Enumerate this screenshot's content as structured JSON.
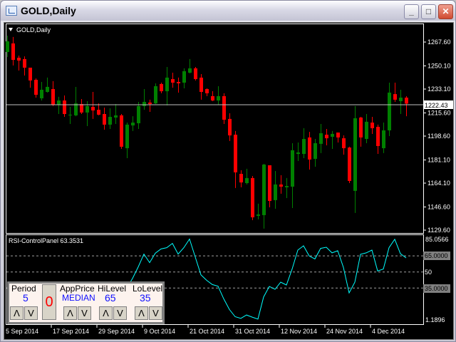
{
  "window": {
    "title": "GOLD,Daily",
    "minimize": "_",
    "maximize": "□",
    "close": "✕"
  },
  "chart": {
    "label": "GOLD,Daily",
    "indicator_label": "RSI-ControlPanel 63.3531",
    "bid": "1222.43",
    "price_ticks": [
      "1267.60",
      "1250.10",
      "1233.10",
      "1215.60",
      "1198.60",
      "1181.10",
      "1164.10",
      "1146.60",
      "1129.60"
    ],
    "rsi_ticks": {
      "max": "85.0566",
      "hi": "65.0000",
      "mid": "50",
      "lo": "35.0000",
      "min": "1.1896"
    },
    "time_labels": [
      "5 Sep 2014",
      "17 Sep 2014",
      "29 Sep 2014",
      "9 Oct 2014",
      "21 Oct 2014",
      "31 Oct 2014",
      "12 Nov 2014",
      "24 Nov 2014",
      "4 Dec 2014"
    ],
    "colors": {
      "bull": "#008000",
      "bear": "#ff0000",
      "rsi": "#00ffff",
      "grid": "#a0a0a0"
    }
  },
  "panel": {
    "period_label": "Period",
    "period_value": "5",
    "reset_label": "0",
    "appprice_label": "AppPrice",
    "appprice_value": "MEDIAN",
    "hilevel_label": "HiLevel",
    "hilevel_value": "65",
    "lolevel_label": "LoLevel",
    "lolevel_value": "35",
    "up": "Λ",
    "down": "V"
  },
  "chart_data": {
    "type": "candlestick",
    "symbol": "GOLD",
    "timeframe": "Daily",
    "ylim": [
      1129.6,
      1267.6
    ],
    "ohlc": [
      [
        1260.3,
        1272.3,
        1256.6,
        1268.1
      ],
      [
        1266.6,
        1271.3,
        1250.4,
        1254.5
      ],
      [
        1256.1,
        1257.7,
        1246.7,
        1254.0
      ],
      [
        1255.1,
        1257.1,
        1243.0,
        1248.8
      ],
      [
        1248.8,
        1248.8,
        1234.1,
        1239.4
      ],
      [
        1239.9,
        1240.9,
        1226.8,
        1228.9
      ],
      [
        1226.3,
        1238.3,
        1224.7,
        1232.6
      ],
      [
        1231.0,
        1241.5,
        1230.5,
        1234.7
      ],
      [
        1233.1,
        1238.9,
        1220.6,
        1221.6
      ],
      [
        1221.6,
        1227.4,
        1214.8,
        1224.7
      ],
      [
        1224.7,
        1228.4,
        1212.7,
        1214.8
      ],
      [
        1214.3,
        1220.0,
        1207.5,
        1214.3
      ],
      [
        1213.8,
        1234.7,
        1213.2,
        1222.6
      ],
      [
        1222.1,
        1225.8,
        1214.8,
        1215.9
      ],
      [
        1215.9,
        1224.2,
        1205.9,
        1220.6
      ],
      [
        1220.0,
        1231.0,
        1211.2,
        1217.4
      ],
      [
        1217.9,
        1222.6,
        1213.8,
        1214.3
      ],
      [
        1214.8,
        1219.5,
        1203.3,
        1207.0
      ],
      [
        1207.0,
        1219.0,
        1203.8,
        1212.7
      ],
      [
        1212.2,
        1222.1,
        1207.5,
        1213.8
      ],
      [
        1213.8,
        1214.8,
        1189.2,
        1190.8
      ],
      [
        1189.7,
        1208.5,
        1182.4,
        1207.0
      ],
      [
        1206.4,
        1213.2,
        1202.3,
        1208.5
      ],
      [
        1208.0,
        1223.7,
        1203.8,
        1220.6
      ],
      [
        1220.6,
        1233.1,
        1217.9,
        1223.7
      ],
      [
        1223.2,
        1225.3,
        1216.4,
        1222.1
      ],
      [
        1222.6,
        1237.3,
        1222.1,
        1235.2
      ],
      [
        1236.8,
        1237.8,
        1230.0,
        1231.5
      ],
      [
        1231.5,
        1249.3,
        1221.1,
        1241.5
      ],
      [
        1240.4,
        1245.1,
        1234.1,
        1237.8
      ],
      [
        1238.3,
        1241.5,
        1230.5,
        1237.3
      ],
      [
        1237.8,
        1248.3,
        1233.6,
        1246.2
      ],
      [
        1245.1,
        1255.1,
        1244.6,
        1248.3
      ],
      [
        1248.3,
        1249.3,
        1239.4,
        1240.4
      ],
      [
        1241.5,
        1244.1,
        1225.3,
        1231.0
      ],
      [
        1233.1,
        1233.6,
        1227.9,
        1230.0
      ],
      [
        1227.9,
        1231.5,
        1224.2,
        1224.7
      ],
      [
        1224.7,
        1235.2,
        1221.6,
        1227.9
      ],
      [
        1227.9,
        1230.0,
        1207.5,
        1210.6
      ],
      [
        1211.2,
        1215.3,
        1195.0,
        1199.1
      ],
      [
        1199.6,
        1202.3,
        1160.5,
        1172.0
      ],
      [
        1170.9,
        1173.5,
        1161.0,
        1164.6
      ],
      [
        1164.1,
        1174.6,
        1163.1,
        1167.8
      ],
      [
        1167.8,
        1169.3,
        1136.9,
        1139.0
      ],
      [
        1140.1,
        1149.0,
        1137.5,
        1141.1
      ],
      [
        1140.6,
        1178.2,
        1130.7,
        1177.7
      ],
      [
        1177.2,
        1177.2,
        1146.3,
        1151.0
      ],
      [
        1151.6,
        1173.0,
        1145.3,
        1163.1
      ],
      [
        1163.1,
        1169.9,
        1156.3,
        1161.5
      ],
      [
        1161.0,
        1167.8,
        1153.1,
        1162.0
      ],
      [
        1161.5,
        1193.4,
        1145.8,
        1188.2
      ],
      [
        1185.5,
        1193.9,
        1180.3,
        1186.6
      ],
      [
        1185.5,
        1204.4,
        1182.4,
        1196.5
      ],
      [
        1197.6,
        1201.7,
        1174.0,
        1181.4
      ],
      [
        1181.9,
        1196.5,
        1176.1,
        1193.4
      ],
      [
        1192.9,
        1207.5,
        1186.1,
        1200.7
      ],
      [
        1199.6,
        1203.8,
        1191.8,
        1197.0
      ],
      [
        1198.1,
        1202.3,
        1189.2,
        1200.2
      ],
      [
        1201.2,
        1201.2,
        1193.9,
        1197.6
      ],
      [
        1197.0,
        1199.1,
        1185.0,
        1189.7
      ],
      [
        1190.2,
        1190.8,
        1164.1,
        1165.7
      ],
      [
        1158.4,
        1220.6,
        1142.2,
        1211.7
      ],
      [
        1212.2,
        1212.7,
        1190.8,
        1197.6
      ],
      [
        1196.5,
        1214.8,
        1193.4,
        1209.1
      ],
      [
        1208.5,
        1212.7,
        1200.2,
        1204.4
      ],
      [
        1205.4,
        1207.0,
        1185.5,
        1191.3
      ],
      [
        1189.7,
        1208.5,
        1186.1,
        1202.8
      ],
      [
        1202.8,
        1237.8,
        1198.6,
        1230.5
      ],
      [
        1229.4,
        1237.8,
        1223.7,
        1225.3
      ],
      [
        1224.2,
        1232.6,
        1214.8,
        1226.8
      ],
      [
        1226.8,
        1227.9,
        1213.2,
        1222.43
      ]
    ],
    "rsi": {
      "name": "RSI-ControlPanel",
      "period": 5,
      "levels": [
        65,
        50,
        35
      ],
      "ylim": [
        1.1896,
        85.0566
      ],
      "start_index": 21,
      "values": [
        35,
        44,
        54.7,
        66.7,
        58.7,
        67.5,
        71.5,
        72.7,
        76.7,
        66.7,
        72.7,
        80.7,
        64,
        47.3,
        42.2,
        38.2,
        36.7,
        24.9,
        14.9,
        8.2,
        6.7,
        9.8,
        7.8,
        6.0,
        26.7,
        36.5,
        33.8,
        40.5,
        37.8,
        52.7,
        70.4,
        74.4,
        64.9,
        62.2,
        72,
        73.1,
        67.8,
        69.8,
        54.2,
        30.4,
        40.4,
        66.5,
        67.8,
        70.4,
        50.9,
        52.7,
        72.7,
        80.5,
        67.1,
        63.1
      ]
    }
  }
}
